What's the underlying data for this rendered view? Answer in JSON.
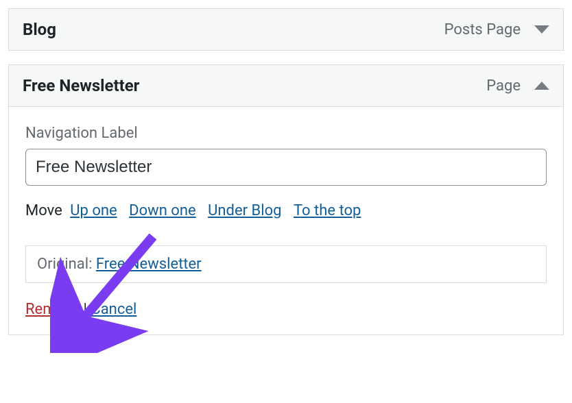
{
  "items": [
    {
      "title": "Blog",
      "type": "Posts Page",
      "expanded": false
    },
    {
      "title": "Free Newsletter",
      "type": "Page",
      "expanded": true,
      "nav_label_caption": "Navigation Label",
      "nav_label_value": "Free Newsletter",
      "move_label": "Move",
      "move_links": {
        "up": "Up one",
        "down": "Down one",
        "under": "Under Blog",
        "top": "To the top"
      },
      "original_label": "Original:",
      "original_link": "Free Newsletter",
      "remove_label": "Remove",
      "separator": " | ",
      "cancel_label": "Cancel"
    }
  ]
}
